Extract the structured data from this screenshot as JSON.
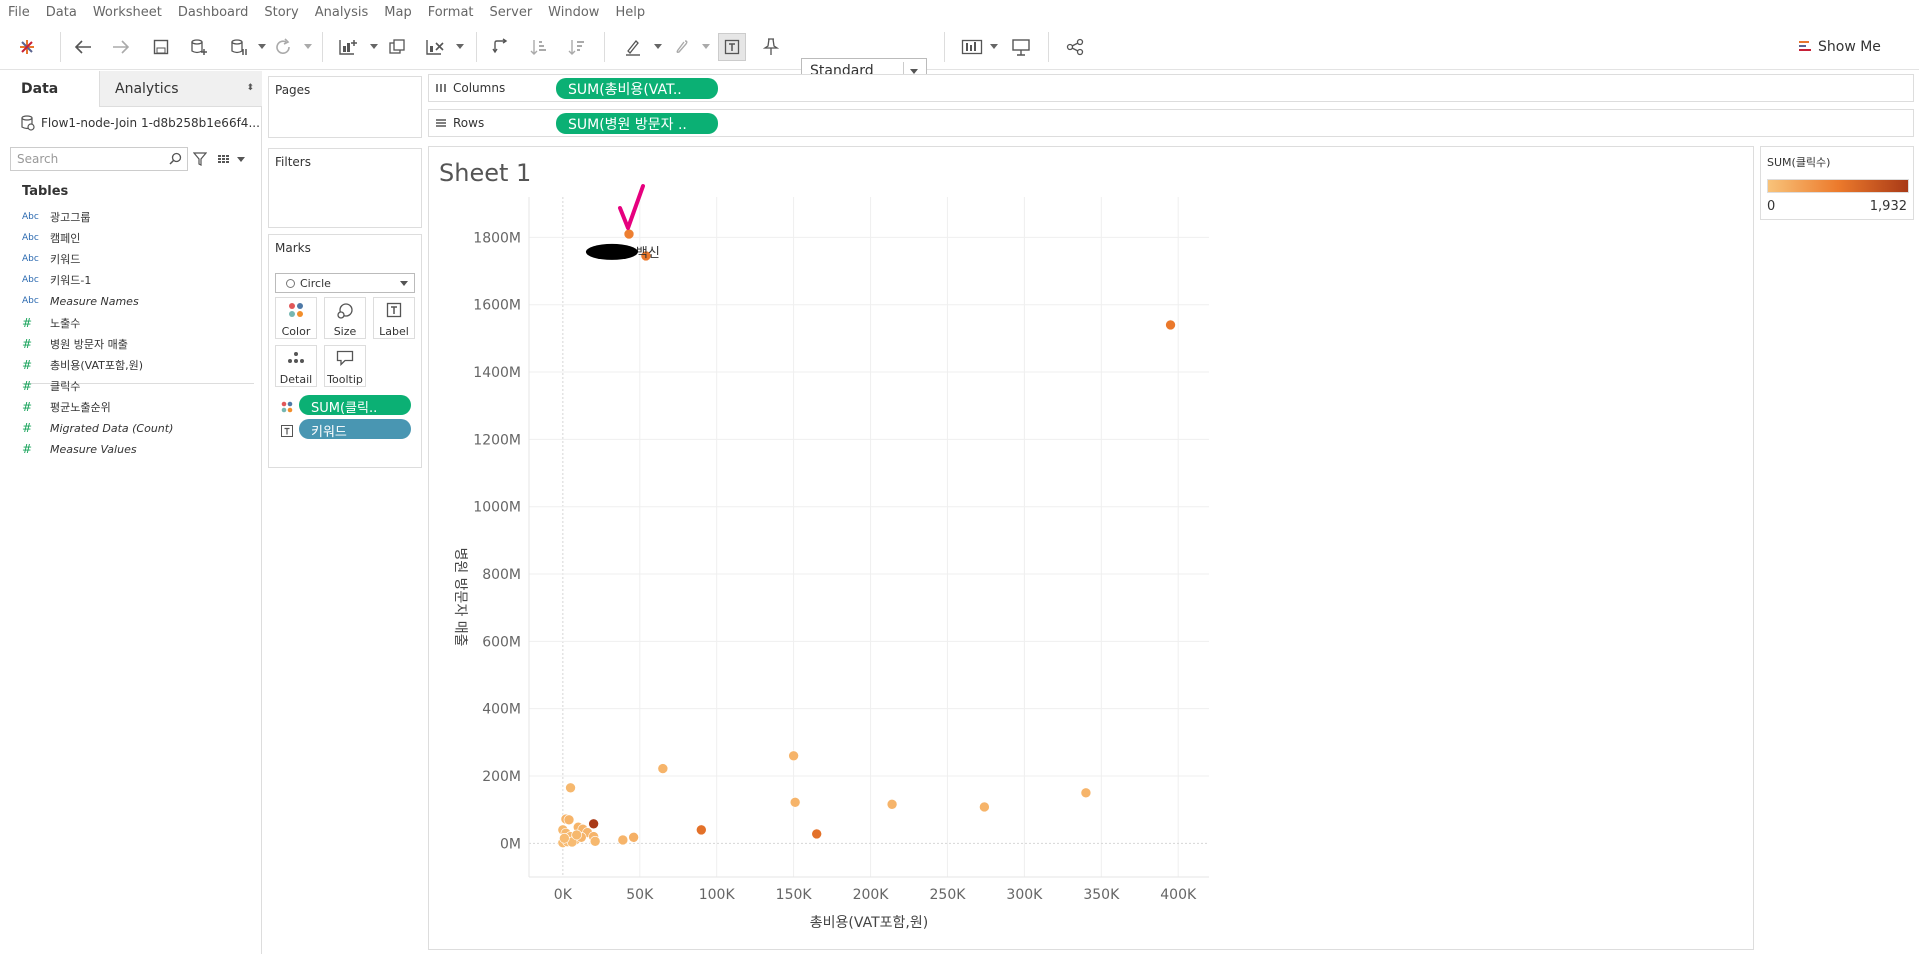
{
  "menu": [
    "File",
    "Data",
    "Worksheet",
    "Dashboard",
    "Story",
    "Analysis",
    "Map",
    "Format",
    "Server",
    "Window",
    "Help"
  ],
  "toolbar": {
    "fit_value": "Standard",
    "show_me_label": "Show Me",
    "icons": [
      "tableau-logo-icon",
      "undo-icon",
      "redo-icon",
      "save-icon",
      "new-datasource-icon",
      "pause-updates-icon",
      "refresh-icon",
      "new-worksheet-icon",
      "duplicate-sheet-icon",
      "clear-sheet-icon",
      "swap-rows-columns-icon",
      "sort-ascending-icon",
      "sort-descending-icon",
      "highlight-icon",
      "group-members-icon",
      "show-mark-labels-icon",
      "fix-axes-icon",
      "show-cards-icon",
      "presentation-mode-icon",
      "share-icon"
    ]
  },
  "data_pane": {
    "tab_data": "Data",
    "tab_analytics": "Analytics",
    "datasource": "Flow1-node-Join 1-d8b258b1e66f4...",
    "search_placeholder": "Search",
    "tables_title": "Tables",
    "fields": [
      {
        "type": "Abc",
        "name": "광고그룹",
        "italic": false
      },
      {
        "type": "Abc",
        "name": "캠페인",
        "italic": false
      },
      {
        "type": "Abc",
        "name": "키워드",
        "italic": false
      },
      {
        "type": "Abc",
        "name": "키워드-1",
        "italic": false
      },
      {
        "type": "Abc",
        "name": "Measure Names",
        "italic": true
      },
      {
        "type": "#",
        "name": "노출수",
        "italic": false
      },
      {
        "type": "#",
        "name": "병원 방문자 매출",
        "italic": false
      },
      {
        "type": "#",
        "name": "총비용(VAT포함,원)",
        "italic": false
      },
      {
        "type": "#",
        "name": "클릭수",
        "italic": false
      },
      {
        "type": "#",
        "name": "평균노출순위",
        "italic": false
      },
      {
        "type": "#",
        "name": "Migrated Data (Count)",
        "italic": true
      },
      {
        "type": "#",
        "name": "Measure Values",
        "italic": true
      }
    ]
  },
  "cards": {
    "pages": "Pages",
    "filters": "Filters",
    "marks": "Marks",
    "mark_type": "Circle",
    "buttons": {
      "color": "Color",
      "size": "Size",
      "label": "Label",
      "detail": "Detail",
      "tooltip": "Tooltip"
    },
    "marks_pills": [
      {
        "text": "SUM(클릭..",
        "color": "#0bb074"
      },
      {
        "text": "키워드",
        "color": "#4996b2"
      }
    ]
  },
  "shelves": {
    "columns_label": "Columns",
    "columns_pill": "SUM(총비용(VAT..",
    "rows_label": "Rows",
    "rows_pill": "SUM(병원 방문자 .."
  },
  "sheet_title": "Sheet 1",
  "legend": {
    "title": "SUM(클릭수)",
    "min": "0",
    "max": "1,932",
    "colors": [
      "#f8c37a",
      "#ec7a2c",
      "#a93a17"
    ]
  },
  "chart_data": {
    "type": "scatter",
    "xlabel": "총비용(VAT포함,원)",
    "ylabel": "병원 방문자 매출",
    "x_ticks": [
      "0K",
      "50K",
      "100K",
      "150K",
      "200K",
      "250K",
      "300K",
      "350K",
      "400K"
    ],
    "y_ticks": [
      "0M",
      "200M",
      "400M",
      "600M",
      "800M",
      "1000M",
      "1200M",
      "1400M",
      "1600M",
      "1800M"
    ],
    "xlim": [
      -22000,
      420000
    ],
    "ylim": [
      -100000000,
      1920000000
    ],
    "grid": true,
    "color_field": "SUM(클릭수)",
    "annotation": "백신",
    "points": [
      {
        "x": 43000,
        "y": 1810000000,
        "c": 900,
        "label": ""
      },
      {
        "x": 54000,
        "y": 1745000000,
        "c": 1000,
        "label": "백신"
      },
      {
        "x": 395000,
        "y": 1540000000,
        "c": 1000
      },
      {
        "x": 5000,
        "y": 165000000,
        "c": 150
      },
      {
        "x": 65000,
        "y": 222000000,
        "c": 200
      },
      {
        "x": 150000,
        "y": 260000000,
        "c": 200
      },
      {
        "x": 151000,
        "y": 122000000,
        "c": 200
      },
      {
        "x": 214000,
        "y": 116000000,
        "c": 200
      },
      {
        "x": 274000,
        "y": 108000000,
        "c": 200
      },
      {
        "x": 340000,
        "y": 150000000,
        "c": 200
      },
      {
        "x": 20000,
        "y": 58000000,
        "c": 1932
      },
      {
        "x": 90000,
        "y": 40000000,
        "c": 1100
      },
      {
        "x": 165000,
        "y": 28000000,
        "c": 1100
      },
      {
        "x": 46000,
        "y": 18000000,
        "c": 250
      },
      {
        "x": 39000,
        "y": 10000000,
        "c": 200
      },
      {
        "x": 2000,
        "y": 72000000,
        "c": 200
      },
      {
        "x": 4000,
        "y": 70000000,
        "c": 200
      },
      {
        "x": 0,
        "y": 40000000,
        "c": 150
      },
      {
        "x": 2000,
        "y": 30000000,
        "c": 150
      },
      {
        "x": 5000,
        "y": 20000000,
        "c": 150
      },
      {
        "x": 8000,
        "y": 10000000,
        "c": 150
      },
      {
        "x": 10000,
        "y": 48000000,
        "c": 200
      },
      {
        "x": 13000,
        "y": 42000000,
        "c": 200
      },
      {
        "x": 16000,
        "y": 32000000,
        "c": 200
      },
      {
        "x": 12000,
        "y": 18000000,
        "c": 200
      },
      {
        "x": 20000,
        "y": 20000000,
        "c": 200
      },
      {
        "x": 21000,
        "y": 6000000,
        "c": 150
      },
      {
        "x": 0,
        "y": 2000000,
        "c": 100
      },
      {
        "x": 3000,
        "y": 5000000,
        "c": 100
      },
      {
        "x": 6000,
        "y": 4000000,
        "c": 100
      },
      {
        "x": 9000,
        "y": 25000000,
        "c": 150
      },
      {
        "x": 1000,
        "y": 15000000,
        "c": 100
      }
    ]
  }
}
